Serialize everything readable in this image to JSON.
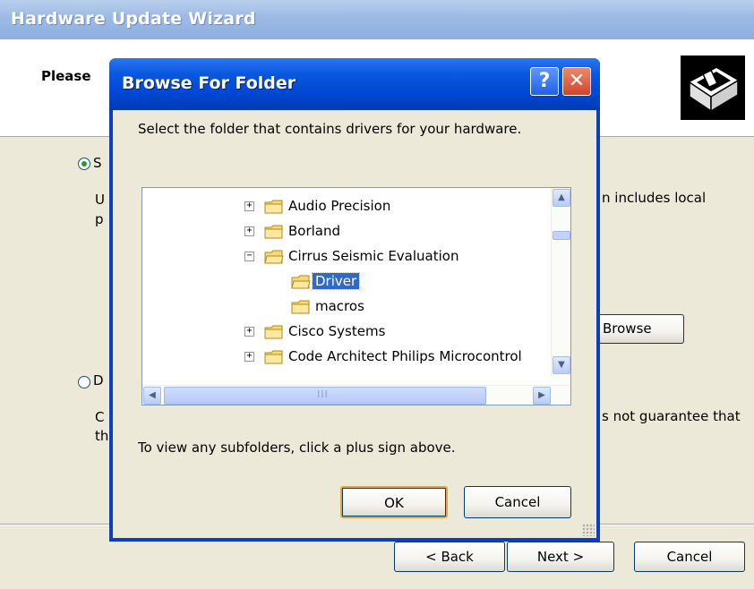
{
  "wizard": {
    "title": "Hardware Update Wizard",
    "header_text": "Please",
    "option1_fragment": "S",
    "option1_desc_line1_fragment": "U",
    "option1_desc_line2_fragment": "p",
    "option1_right_text": "n includes local",
    "browse_label": "Browse",
    "option2_fragment": "D",
    "option2_desc_line1_fragment": "C",
    "option2_desc_line2_fragment": "th",
    "option2_right_text": "s not guarantee that",
    "back_label": "< Back",
    "next_label": "Next >",
    "cancel_label": "Cancel"
  },
  "dialog": {
    "title": "Browse For Folder",
    "help_glyph": "?",
    "close_glyph": "✕",
    "instruction": "Select the folder that contains drivers for your hardware.",
    "tree": [
      {
        "label": "Audio Precision",
        "expander": "+",
        "selected": false
      },
      {
        "label": "Borland",
        "expander": "+",
        "selected": false
      },
      {
        "label": "Cirrus Seismic Evaluation",
        "expander": "−",
        "selected": false
      },
      {
        "label": "Driver",
        "expander": "",
        "selected": true
      },
      {
        "label": "macros",
        "expander": "",
        "selected": false
      },
      {
        "label": "Cisco Systems",
        "expander": "+",
        "selected": false
      },
      {
        "label": "Code Architect Philips Microcontrol",
        "expander": "+",
        "selected": false
      }
    ],
    "hint": "To view any subfolders, click a plus sign above.",
    "ok_label": "OK",
    "cancel_label": "Cancel"
  }
}
